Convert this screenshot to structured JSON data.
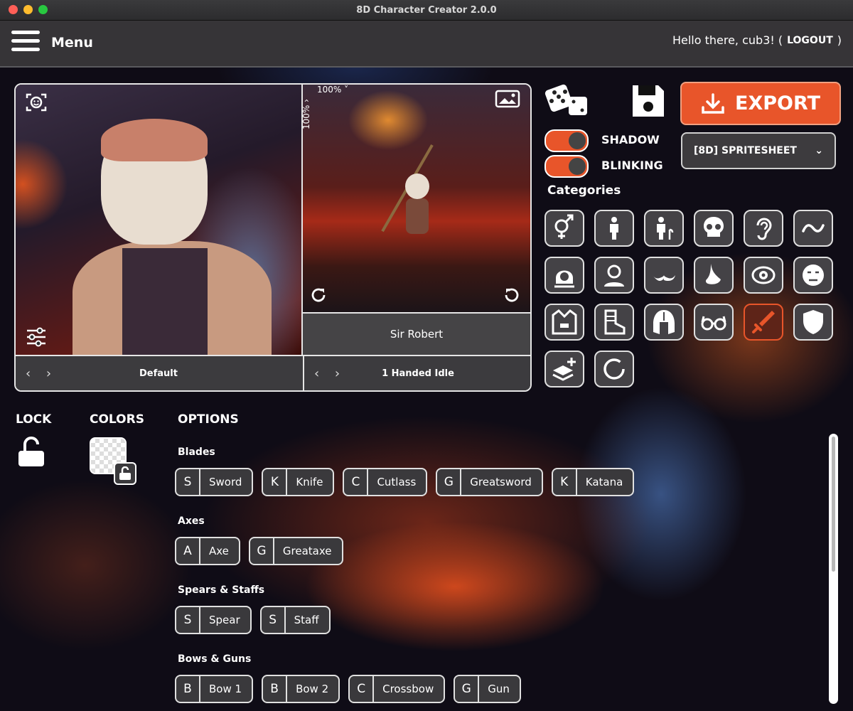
{
  "window": {
    "title": "8D Character Creator 2.0.0"
  },
  "header": {
    "menu_label": "Menu",
    "greeting_prefix": "Hello there, cub3! (",
    "logout_label": "LOGOUT",
    "greeting_suffix": ")"
  },
  "viewer": {
    "zoom_h": "100%",
    "zoom_v": "100%",
    "character_name": "Sir Robert",
    "portrait_pose": "Default",
    "animation": "1 Handed Idle"
  },
  "toolbar": {
    "export_label": "EXPORT",
    "shadow_label": "SHADOW",
    "blinking_label": "BLINKING",
    "shadow_on": true,
    "blinking_on": true,
    "export_format": "[8D] SPRITESHEET"
  },
  "categories": {
    "title": "Categories",
    "items": [
      {
        "icon": "gender-icon"
      },
      {
        "icon": "body-icon"
      },
      {
        "icon": "age-icon"
      },
      {
        "icon": "skull-icon"
      },
      {
        "icon": "ear-icon"
      },
      {
        "icon": "tail-icon"
      },
      {
        "icon": "hair-icon"
      },
      {
        "icon": "head-icon"
      },
      {
        "icon": "mustache-icon"
      },
      {
        "icon": "nose-icon"
      },
      {
        "icon": "eye-icon"
      },
      {
        "icon": "expression-icon"
      },
      {
        "icon": "shirt-icon"
      },
      {
        "icon": "boot-icon"
      },
      {
        "icon": "helmet-icon"
      },
      {
        "icon": "glasses-icon"
      },
      {
        "icon": "sword-icon",
        "active": true
      },
      {
        "icon": "shield-icon"
      },
      {
        "icon": "layers-add-icon"
      },
      {
        "icon": "loading-ring-icon"
      }
    ]
  },
  "panel": {
    "lock_title": "LOCK",
    "colors_title": "COLORS",
    "options_title": "OPTIONS"
  },
  "colors": {
    "accent": "#e8552a",
    "panel": "#3a393c",
    "border": "#e0e0e0"
  },
  "groups": [
    {
      "title": "Blades",
      "items": [
        {
          "key": "S",
          "name": "Sword"
        },
        {
          "key": "K",
          "name": "Knife"
        },
        {
          "key": "C",
          "name": "Cutlass"
        },
        {
          "key": "G",
          "name": "Greatsword"
        },
        {
          "key": "K",
          "name": "Katana"
        }
      ]
    },
    {
      "title": "Axes",
      "items": [
        {
          "key": "A",
          "name": "Axe"
        },
        {
          "key": "G",
          "name": "Greataxe"
        }
      ]
    },
    {
      "title": "Spears & Staffs",
      "items": [
        {
          "key": "S",
          "name": "Spear"
        },
        {
          "key": "S",
          "name": "Staff"
        }
      ]
    },
    {
      "title": "Bows & Guns",
      "items": [
        {
          "key": "B",
          "name": "Bow 1"
        },
        {
          "key": "B",
          "name": "Bow 2"
        },
        {
          "key": "C",
          "name": "Crossbow"
        },
        {
          "key": "G",
          "name": "Gun"
        }
      ]
    }
  ]
}
